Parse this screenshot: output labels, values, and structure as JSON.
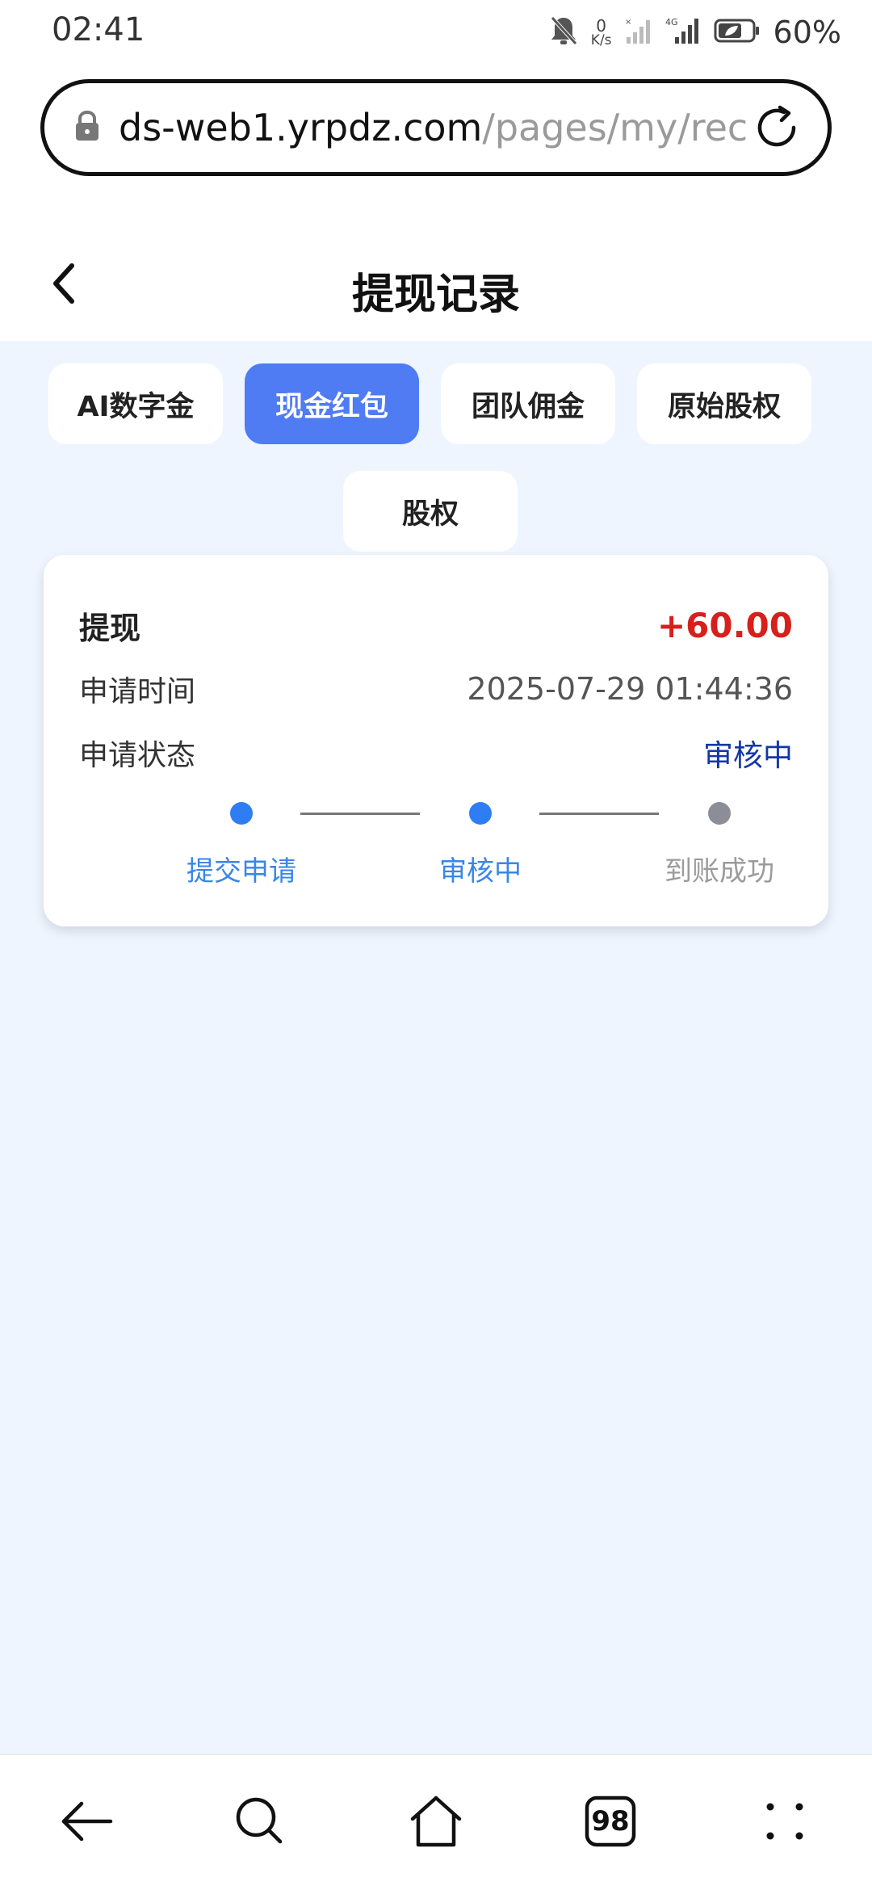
{
  "status_bar": {
    "time": "02:41",
    "net_speed_value": "0",
    "net_speed_unit": "K/s",
    "battery": "60%"
  },
  "url_bar": {
    "domain": "ds-web1.yrpdz.com",
    "path": "/pages/my/rec"
  },
  "header": {
    "title": "提现记录"
  },
  "tabs": [
    {
      "label": "AI数字金",
      "active": false
    },
    {
      "label": "现金红包",
      "active": true
    },
    {
      "label": "团队佣金",
      "active": false
    },
    {
      "label": "原始股权",
      "active": false
    },
    {
      "label": "股权",
      "active": false
    }
  ],
  "record": {
    "type_label": "提现",
    "amount": "+60.00",
    "time_label": "申请时间",
    "time_value": "2025-07-29 01:44:36",
    "status_label": "申请状态",
    "status_value": "审核中",
    "steps": [
      {
        "label": "提交申请",
        "done": true
      },
      {
        "label": "审核中",
        "done": true
      },
      {
        "label": "到账成功",
        "done": false
      }
    ]
  },
  "bottom_nav": {
    "tab_count": "98"
  },
  "colors": {
    "accent": "#4f7bf3",
    "amount": "#d7201b",
    "status": "#1436a8",
    "step_done": "#2f7df4",
    "step_pending": "#8b8e96",
    "background": "#eef5ff"
  }
}
